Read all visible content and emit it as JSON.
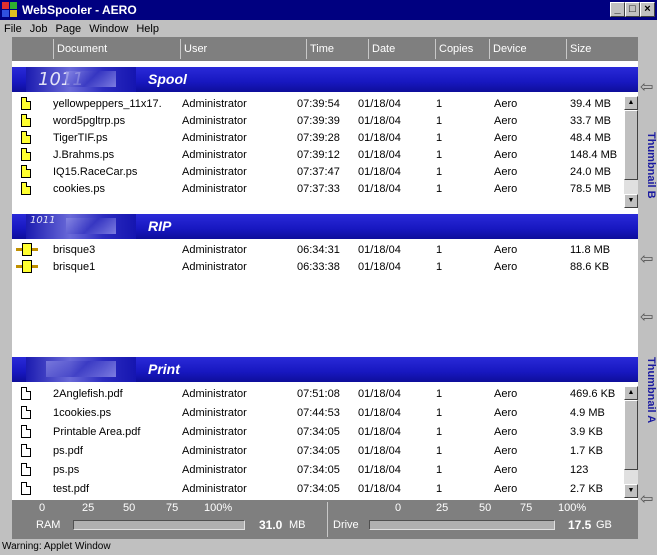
{
  "window": {
    "title": "WebSpooler - AERO",
    "controls": {
      "minimize": "_",
      "maximize": "□",
      "close": "×"
    }
  },
  "menu": [
    "File",
    "Job",
    "Page",
    "Window",
    "Help"
  ],
  "columns": [
    "Document",
    "User",
    "Time",
    "Date",
    "Copies",
    "Device",
    "Size"
  ],
  "sections": {
    "spool": {
      "label": "Spool",
      "rows": [
        {
          "doc": "yellowpeppers_11x17.",
          "user": "Administrator",
          "time": "07:39:54",
          "date": "01/18/04",
          "copies": "1",
          "device": "Aero",
          "size": "39.4 MB"
        },
        {
          "doc": "word5pgltrp.ps",
          "user": "Administrator",
          "time": "07:39:39",
          "date": "01/18/04",
          "copies": "1",
          "device": "Aero",
          "size": "33.7 MB"
        },
        {
          "doc": "TigerTIF.ps",
          "user": "Administrator",
          "time": "07:39:28",
          "date": "01/18/04",
          "copies": "1",
          "device": "Aero",
          "size": "48.4 MB"
        },
        {
          "doc": "J.Brahms.ps",
          "user": "Administrator",
          "time": "07:39:12",
          "date": "01/18/04",
          "copies": "1",
          "device": "Aero",
          "size": "148.4 MB"
        },
        {
          "doc": "IQ15.RaceCar.ps",
          "user": "Administrator",
          "time": "07:37:47",
          "date": "01/18/04",
          "copies": "1",
          "device": "Aero",
          "size": "24.0 MB"
        },
        {
          "doc": "cookies.ps",
          "user": "Administrator",
          "time": "07:37:33",
          "date": "01/18/04",
          "copies": "1",
          "device": "Aero",
          "size": "78.5 MB"
        }
      ]
    },
    "rip": {
      "label": "RIP",
      "rows": [
        {
          "doc": "brisque3",
          "user": "Administrator",
          "time": "06:34:31",
          "date": "01/18/04",
          "copies": "1",
          "device": "Aero",
          "size": "11.8 MB"
        },
        {
          "doc": "brisque1",
          "user": "Administrator",
          "time": "06:33:38",
          "date": "01/18/04",
          "copies": "1",
          "device": "Aero",
          "size": "88.6 KB"
        }
      ]
    },
    "print": {
      "label": "Print",
      "rows": [
        {
          "doc": "2Anglefish.pdf",
          "user": "Administrator",
          "time": "07:51:08",
          "date": "01/18/04",
          "copies": "1",
          "device": "Aero",
          "size": "469.6 KB"
        },
        {
          "doc": "1cookies.ps",
          "user": "Administrator",
          "time": "07:44:53",
          "date": "01/18/04",
          "copies": "1",
          "device": "Aero",
          "size": "4.9 MB"
        },
        {
          "doc": "Printable Area.pdf",
          "user": "Administrator",
          "time": "07:34:05",
          "date": "01/18/04",
          "copies": "1",
          "device": "Aero",
          "size": "3.9 KB"
        },
        {
          "doc": "ps.pdf",
          "user": "Administrator",
          "time": "07:34:05",
          "date": "01/18/04",
          "copies": "1",
          "device": "Aero",
          "size": "1.7 KB"
        },
        {
          "doc": "ps.ps",
          "user": "Administrator",
          "time": "07:34:05",
          "date": "01/18/04",
          "copies": "1",
          "device": "Aero",
          "size": "123"
        },
        {
          "doc": "test.pdf",
          "user": "Administrator",
          "time": "07:34:05",
          "date": "01/18/04",
          "copies": "1",
          "device": "Aero",
          "size": "2.7 KB"
        }
      ]
    }
  },
  "side_tabs": {
    "top": "Thumbnail B",
    "bottom": "Thumbnail A"
  },
  "meters": {
    "ticks": [
      "0",
      "25",
      "50",
      "75",
      "100%"
    ],
    "ram": {
      "label": "RAM",
      "value": "31.0",
      "unit": "MB",
      "fill_fraction": 0.0
    },
    "drive": {
      "label": "Drive",
      "value": "17.5",
      "unit": "GB",
      "fill_fraction": 0.0
    }
  },
  "status": "Warning: Applet Window",
  "colors": {
    "titlebar": "#000080",
    "section": "#1a1ac8",
    "header": "#7f7f7f",
    "doc_yellow": "#ffff30"
  }
}
